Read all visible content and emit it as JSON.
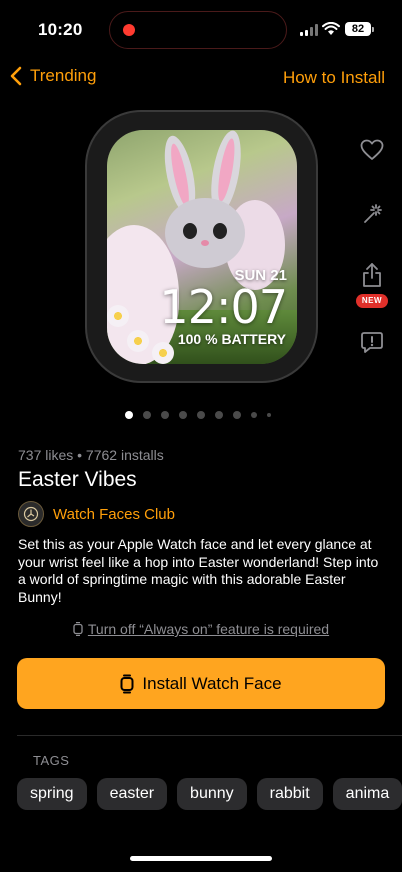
{
  "status_bar": {
    "time": "10:20",
    "battery": "82"
  },
  "nav": {
    "back_label": "Trending",
    "right_label": "How to Install"
  },
  "watch_face": {
    "date": "SUN 21",
    "time": "12:07",
    "battery_text": "100 % BATTERY"
  },
  "side_actions": {
    "new_badge": "NEW",
    "icons": [
      "heart-icon",
      "sparkle-icon",
      "share-icon",
      "report-icon"
    ]
  },
  "pager": {
    "pages": 9,
    "current_page": 1
  },
  "info": {
    "stats": "737 likes • 7762 installs",
    "title": "Easter Vibes",
    "author": "Watch Faces Club",
    "description": "Set this as your Apple Watch face and let every glance at your wrist feel like a hop into Easter wonderland! Step into a world of springtime magic with this adorable Easter Bunny!"
  },
  "notice": {
    "text": "Turn off “Always on” feature is required"
  },
  "install_button": {
    "label": "Install Watch Face"
  },
  "tags": {
    "label": "TAGS",
    "items": [
      "spring",
      "easter",
      "bunny",
      "rabbit",
      "anima"
    ]
  },
  "colors": {
    "accent": "#ff9f0a",
    "button": "#ffa51f",
    "badge": "#e0302a",
    "background": "#000000"
  }
}
